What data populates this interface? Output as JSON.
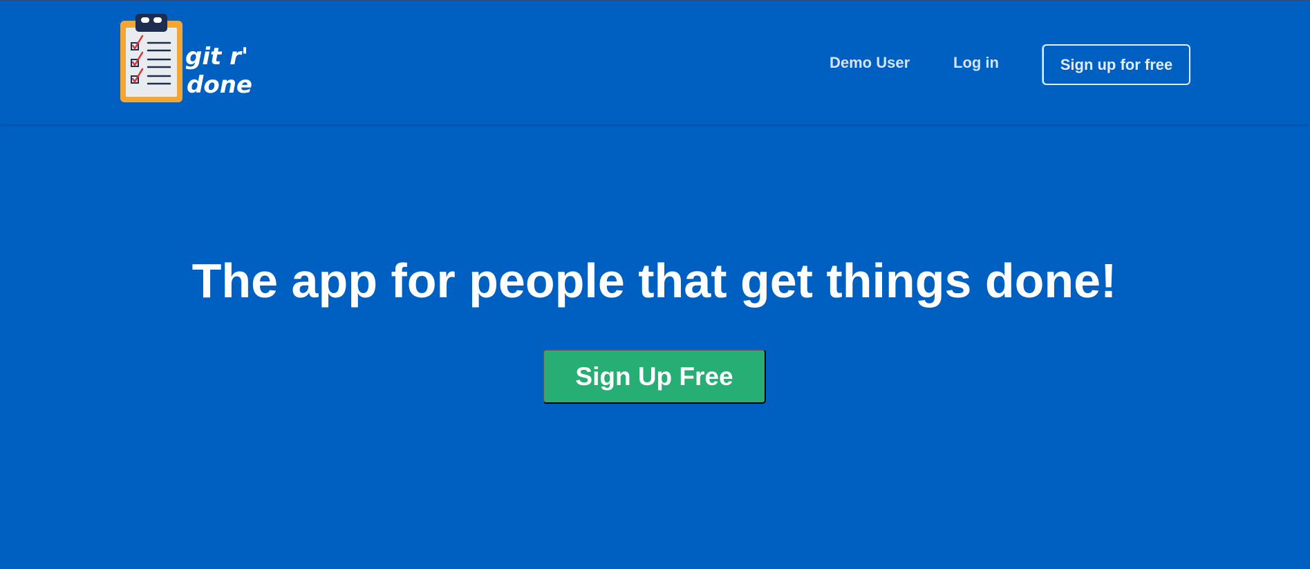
{
  "header": {
    "logo": {
      "line1": "git r'",
      "line2": "done",
      "icon": "clipboard-checklist-icon"
    },
    "nav": {
      "demo_user": "Demo User",
      "login": "Log in",
      "signup": "Sign up for free"
    }
  },
  "hero": {
    "title": "The app for people that get things done!",
    "cta_label": "Sign Up Free"
  },
  "colors": {
    "background": "#0060c2",
    "cta": "#27ae74",
    "clipboard_frame": "#f3a633",
    "clipboard_clip": "#1c2d4f",
    "check_mark": "#d9343a"
  }
}
